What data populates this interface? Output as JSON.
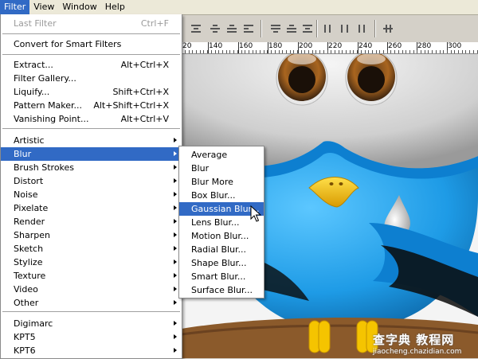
{
  "menubar": {
    "items": [
      {
        "label": "Filter",
        "active": true
      },
      {
        "label": "View",
        "active": false
      },
      {
        "label": "Window",
        "active": false
      },
      {
        "label": "Help",
        "active": false
      }
    ]
  },
  "ruler": {
    "labels": [
      "20",
      "140",
      "160",
      "180",
      "200",
      "220",
      "240",
      "260",
      "280",
      "300"
    ]
  },
  "filter_menu": {
    "last_filter": {
      "label": "Last Filter",
      "shortcut": "Ctrl+F",
      "disabled": true
    },
    "convert": {
      "label": "Convert for Smart Filters"
    },
    "group1": [
      {
        "label": "Extract...",
        "shortcut": "Alt+Ctrl+X"
      },
      {
        "label": "Filter Gallery..."
      },
      {
        "label": "Liquify...",
        "shortcut": "Shift+Ctrl+X"
      },
      {
        "label": "Pattern Maker...",
        "shortcut": "Alt+Shift+Ctrl+X"
      },
      {
        "label": "Vanishing Point...",
        "shortcut": "Alt+Ctrl+V"
      }
    ],
    "group2": [
      {
        "label": "Artistic"
      },
      {
        "label": "Blur",
        "highlighted": true
      },
      {
        "label": "Brush Strokes"
      },
      {
        "label": "Distort"
      },
      {
        "label": "Noise"
      },
      {
        "label": "Pixelate"
      },
      {
        "label": "Render"
      },
      {
        "label": "Sharpen"
      },
      {
        "label": "Sketch"
      },
      {
        "label": "Stylize"
      },
      {
        "label": "Texture"
      },
      {
        "label": "Video"
      },
      {
        "label": "Other"
      }
    ],
    "group3": [
      {
        "label": "Digimarc"
      },
      {
        "label": "KPT5"
      },
      {
        "label": "KPT6"
      }
    ]
  },
  "blur_menu": {
    "items": [
      {
        "label": "Average"
      },
      {
        "label": "Blur"
      },
      {
        "label": "Blur More"
      },
      {
        "label": "Box Blur..."
      },
      {
        "label": "Gaussian Blur...",
        "highlighted": true
      },
      {
        "label": "Lens Blur..."
      },
      {
        "label": "Motion Blur..."
      },
      {
        "label": "Radial Blur..."
      },
      {
        "label": "Shape Blur..."
      },
      {
        "label": "Smart Blur..."
      },
      {
        "label": "Surface Blur..."
      }
    ]
  },
  "watermark": {
    "brand": "查字典 教程网",
    "url": "jiaocheng.chazidian.com"
  },
  "colors": {
    "highlight": "#316ac5",
    "bird_blue": "#1e9be6",
    "beak_yellow": "#f5c400",
    "branch_brown": "#8b5a2b"
  }
}
